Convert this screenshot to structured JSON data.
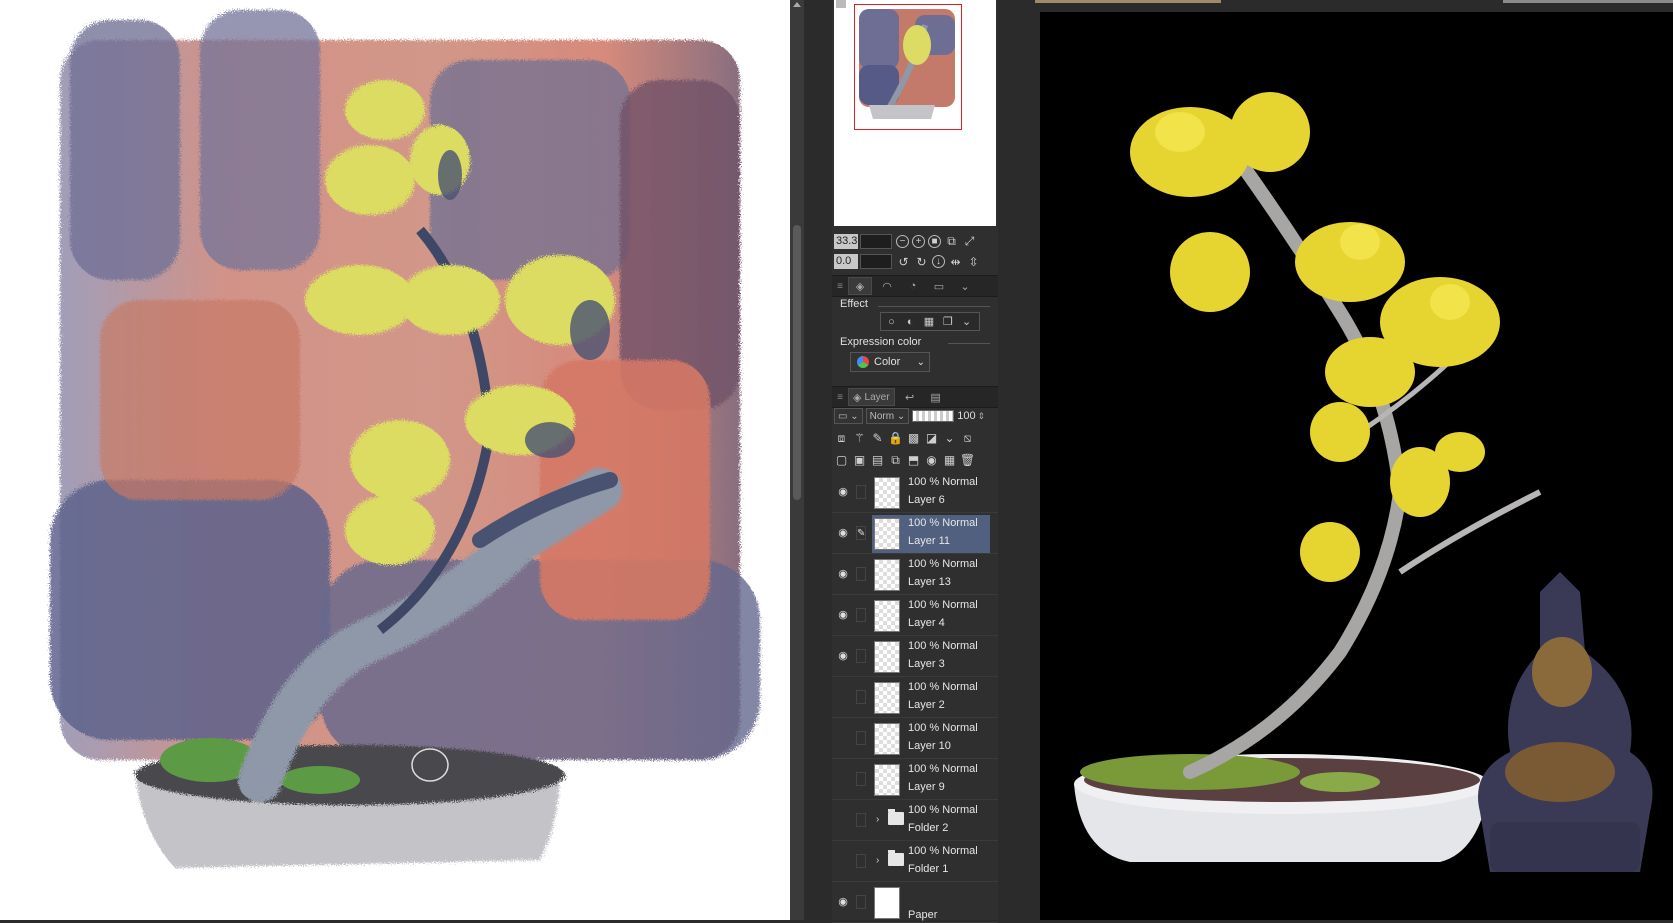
{
  "navigator": {
    "zoom_value": "33.3",
    "rotate_value": "0.0"
  },
  "layer_property": {
    "effect_label": "Effect",
    "expression_color_label": "Expression color",
    "expression_color_value": "Color"
  },
  "layer_panel": {
    "tab_label": "Layer",
    "blend_mode": "Norm",
    "opacity": "100",
    "layers": [
      {
        "mode": "100 % Normal",
        "name": "Layer 6",
        "visible": true,
        "selected": false,
        "kind": "layer"
      },
      {
        "mode": "100 % Normal",
        "name": "Layer 11",
        "visible": true,
        "selected": true,
        "kind": "layer"
      },
      {
        "mode": "100 % Normal",
        "name": "Layer 13",
        "visible": true,
        "selected": false,
        "kind": "layer"
      },
      {
        "mode": "100 % Normal",
        "name": "Layer 4",
        "visible": true,
        "selected": false,
        "kind": "layer"
      },
      {
        "mode": "100 % Normal",
        "name": "Layer 3",
        "visible": true,
        "selected": false,
        "kind": "layer"
      },
      {
        "mode": "100 % Normal",
        "name": "Layer 2",
        "visible": false,
        "selected": false,
        "kind": "layer"
      },
      {
        "mode": "100 % Normal",
        "name": "Layer 10",
        "visible": false,
        "selected": false,
        "kind": "layer"
      },
      {
        "mode": "100 % Normal",
        "name": "Layer 9",
        "visible": false,
        "selected": false,
        "kind": "layer"
      },
      {
        "mode": "100 % Normal",
        "name": "Folder 2",
        "visible": false,
        "selected": false,
        "kind": "folder"
      },
      {
        "mode": "100 % Normal",
        "name": "Folder 1",
        "visible": false,
        "selected": false,
        "kind": "folder"
      },
      {
        "mode": "",
        "name": "Paper",
        "visible": true,
        "selected": false,
        "kind": "paper"
      }
    ]
  },
  "colors": {
    "selected_layer": "#51607e",
    "navigator_frame": "#e02020",
    "panel_bg": "#2f2f2f"
  }
}
